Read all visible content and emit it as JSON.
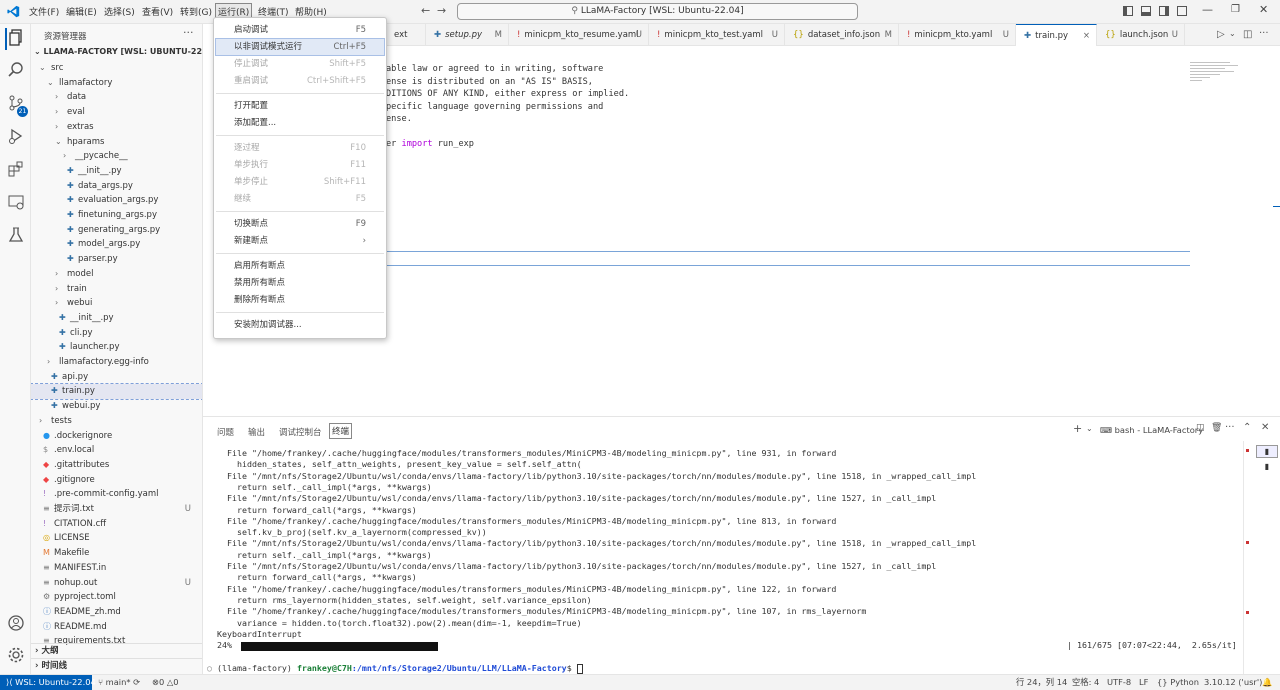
{
  "menubar": {
    "items": [
      "文件(F)",
      "编辑(E)",
      "选择(S)",
      "查看(V)",
      "转到(G)",
      "运行(R)",
      "终端(T)",
      "帮助(H)"
    ]
  },
  "command_center": {
    "text": "LLaMA-Factory [WSL: Ubuntu-22.04]"
  },
  "sidebar": {
    "title": "资源管理器",
    "root": "LLAMA-FACTORY [WSL: UBUNTU-22.04]",
    "rows": [
      {
        "label": "src",
        "depth": 1,
        "kind": "folder-open"
      },
      {
        "label": "llamafactory",
        "depth": 2,
        "kind": "folder-open"
      },
      {
        "label": "data",
        "depth": 3,
        "kind": "folder"
      },
      {
        "label": "eval",
        "depth": 3,
        "kind": "folder"
      },
      {
        "label": "extras",
        "depth": 3,
        "kind": "folder"
      },
      {
        "label": "hparams",
        "depth": 3,
        "kind": "folder-open"
      },
      {
        "label": "__pycache__",
        "depth": 4,
        "kind": "folder"
      },
      {
        "label": "__init__.py",
        "depth": 4,
        "kind": "py"
      },
      {
        "label": "data_args.py",
        "depth": 4,
        "kind": "py"
      },
      {
        "label": "evaluation_args.py",
        "depth": 4,
        "kind": "py"
      },
      {
        "label": "finetuning_args.py",
        "depth": 4,
        "kind": "py"
      },
      {
        "label": "generating_args.py",
        "depth": 4,
        "kind": "py"
      },
      {
        "label": "model_args.py",
        "depth": 4,
        "kind": "py"
      },
      {
        "label": "parser.py",
        "depth": 4,
        "kind": "py"
      },
      {
        "label": "model",
        "depth": 3,
        "kind": "folder"
      },
      {
        "label": "train",
        "depth": 3,
        "kind": "folder"
      },
      {
        "label": "webui",
        "depth": 3,
        "kind": "folder"
      },
      {
        "label": "__init__.py",
        "depth": 3,
        "kind": "py"
      },
      {
        "label": "cli.py",
        "depth": 3,
        "kind": "py"
      },
      {
        "label": "launcher.py",
        "depth": 3,
        "kind": "py"
      },
      {
        "label": "llamafactory.egg-info",
        "depth": 2,
        "kind": "folder"
      },
      {
        "label": "api.py",
        "depth": 2,
        "kind": "py"
      },
      {
        "label": "train.py",
        "depth": 2,
        "kind": "py",
        "selected": true
      },
      {
        "label": "webui.py",
        "depth": 2,
        "kind": "py"
      },
      {
        "label": "tests",
        "depth": 1,
        "kind": "folder"
      },
      {
        "label": ".dockerignore",
        "depth": 1,
        "kind": "docker"
      },
      {
        "label": ".env.local",
        "depth": 1,
        "kind": "env"
      },
      {
        "label": ".gitattributes",
        "depth": 1,
        "kind": "git"
      },
      {
        "label": ".gitignore",
        "depth": 1,
        "kind": "git"
      },
      {
        "label": ".pre-commit-config.yaml",
        "depth": 1,
        "kind": "yaml"
      },
      {
        "label": "提示词.txt",
        "depth": 1,
        "kind": "txt",
        "badge": "U"
      },
      {
        "label": "CITATION.cff",
        "depth": 1,
        "kind": "yaml"
      },
      {
        "label": "LICENSE",
        "depth": 1,
        "kind": "license"
      },
      {
        "label": "Makefile",
        "depth": 1,
        "kind": "make"
      },
      {
        "label": "MANIFEST.in",
        "depth": 1,
        "kind": "txt"
      },
      {
        "label": "nohup.out",
        "depth": 1,
        "kind": "txt",
        "badge": "U"
      },
      {
        "label": "pyproject.toml",
        "depth": 1,
        "kind": "toml"
      },
      {
        "label": "README_zh.md",
        "depth": 1,
        "kind": "md"
      },
      {
        "label": "README.md",
        "depth": 1,
        "kind": "md"
      },
      {
        "label": "requirements.txt",
        "depth": 1,
        "kind": "txt"
      }
    ],
    "outline_label": "大纲",
    "timeline_label": "时间线"
  },
  "tabs": [
    {
      "label": "ext",
      "badge": "",
      "icon": ""
    },
    {
      "label": "setup.py",
      "badge": "M",
      "icon": "py"
    },
    {
      "label": "minicpm_kto_resume.yaml",
      "badge": "U",
      "icon": "!"
    },
    {
      "label": "minicpm_kto_test.yaml",
      "badge": "U",
      "icon": "!"
    },
    {
      "label": "dataset_info.json",
      "badge": "M",
      "icon": "{}"
    },
    {
      "label": "minicpm_kto.yaml",
      "badge": "U",
      "icon": "!"
    },
    {
      "label": "train.py",
      "badge": "×",
      "icon": "py",
      "active": true
    },
    {
      "label": "launch.json",
      "badge": "U",
      "icon": "{}"
    }
  ],
  "editor": {
    "lines": [
      "able law or agreed to in writing, software",
      "ense is distributed on an \"AS IS\" BASIS,",
      "DITIONS OF ANY KIND, either express or implied.",
      "pecific language governing permissions and",
      "ense.",
      "",
      "er import run_exp"
    ]
  },
  "run_menu": {
    "items": [
      {
        "label": "启动调试",
        "shortcut": "F5",
        "disabled": false
      },
      {
        "label": "以非调试模式运行",
        "shortcut": "Ctrl+F5",
        "disabled": false,
        "highlight": true
      },
      {
        "label": "停止调试",
        "shortcut": "Shift+F5",
        "disabled": true
      },
      {
        "label": "重启调试",
        "shortcut": "Ctrl+Shift+F5",
        "disabled": true
      },
      {
        "sep": true
      },
      {
        "label": "打开配置",
        "shortcut": "",
        "disabled": false
      },
      {
        "label": "添加配置...",
        "shortcut": "",
        "disabled": false
      },
      {
        "sep": true
      },
      {
        "label": "逐过程",
        "shortcut": "F10",
        "disabled": true
      },
      {
        "label": "单步执行",
        "shortcut": "F11",
        "disabled": true
      },
      {
        "label": "单步停止",
        "shortcut": "Shift+F11",
        "disabled": true
      },
      {
        "label": "继续",
        "shortcut": "F5",
        "disabled": true
      },
      {
        "sep": true
      },
      {
        "label": "切换断点",
        "shortcut": "F9",
        "disabled": false
      },
      {
        "label": "新建断点",
        "shortcut": "›",
        "disabled": false
      },
      {
        "sep": true
      },
      {
        "label": "启用所有断点",
        "shortcut": "",
        "disabled": false
      },
      {
        "label": "禁用所有断点",
        "shortcut": "",
        "disabled": false
      },
      {
        "label": "删除所有断点",
        "shortcut": "",
        "disabled": false
      },
      {
        "sep": true
      },
      {
        "label": "安装附加调试器...",
        "shortcut": "",
        "disabled": false
      }
    ]
  },
  "panel": {
    "tabs": [
      "问题",
      "输出",
      "调试控制台",
      "终端"
    ],
    "active_tab": "终端",
    "terminal_name": "bash - LLaMA-Factory",
    "lines": [
      "  File \"/home/frankey/.cache/huggingface/modules/transformers_modules/MiniCPM3-4B/modeling_minicpm.py\", line 931, in forward",
      "    hidden_states, self_attn_weights, present_key_value = self.self_attn(",
      "  File \"/mnt/nfs/Storage2/Ubuntu/wsl/conda/envs/llama-factory/lib/python3.10/site-packages/torch/nn/modules/module.py\", line 1518, in _wrapped_call_impl",
      "    return self._call_impl(*args, **kwargs)",
      "  File \"/mnt/nfs/Storage2/Ubuntu/wsl/conda/envs/llama-factory/lib/python3.10/site-packages/torch/nn/modules/module.py\", line 1527, in _call_impl",
      "    return forward_call(*args, **kwargs)",
      "  File \"/home/frankey/.cache/huggingface/modules/transformers_modules/MiniCPM3-4B/modeling_minicpm.py\", line 813, in forward",
      "    self.kv_b_proj(self.kv_a_layernorm(compressed_kv))",
      "  File \"/mnt/nfs/Storage2/Ubuntu/wsl/conda/envs/llama-factory/lib/python3.10/site-packages/torch/nn/modules/module.py\", line 1518, in _wrapped_call_impl",
      "    return self._call_impl(*args, **kwargs)",
      "  File \"/mnt/nfs/Storage2/Ubuntu/wsl/conda/envs/llama-factory/lib/python3.10/site-packages/torch/nn/modules/module.py\", line 1527, in _call_impl",
      "    return forward_call(*args, **kwargs)",
      "  File \"/home/frankey/.cache/huggingface/modules/transformers_modules/MiniCPM3-4B/modeling_minicpm.py\", line 122, in forward",
      "    return rms_layernorm(hidden_states, self.weight, self.variance_epsilon)",
      "  File \"/home/frankey/.cache/huggingface/modules/transformers_modules/MiniCPM3-4B/modeling_minicpm.py\", line 107, in rms_layernorm",
      "    variance = hidden.to(torch.float32).pow(2).mean(dim=-1, keepdim=True)",
      "KeyboardInterrupt"
    ],
    "progress_percent": "24%",
    "progress_fraction": 0.24,
    "progress_stats": "| 161/675 [07:07<22:44,  2.65s/it]",
    "prompt_env": "(llama-factory)",
    "prompt_user": "frankey@C7H",
    "prompt_path": ":/mnt/nfs/Storage2/Ubuntu/LLM/LLaMA-Factory",
    "prompt_symbol": "$"
  },
  "statusbar": {
    "remote": "WSL: Ubuntu-22.04",
    "branch": "main*",
    "problems": "0",
    "warnings": "0",
    "position": "行 24，列 14",
    "spaces": "空格: 4",
    "encoding": "UTF-8",
    "eol": "LF",
    "language": "Python",
    "version": "3.10.12 ('usr')"
  },
  "colors": {
    "accent": "#005fb8",
    "remote_bg": "#005fb8",
    "keyword": "#af00db"
  }
}
